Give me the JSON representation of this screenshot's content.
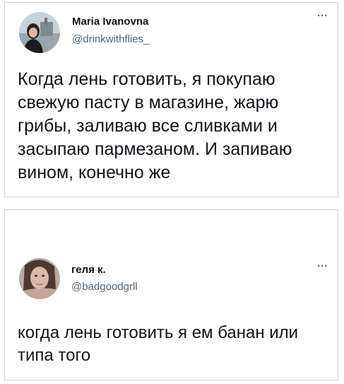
{
  "tweets": [
    {
      "author_name": "Maria Ivanovna",
      "handle": "@drinkwithflies_",
      "more_label": "···",
      "text": "Когда лень готовить, я покупаю свежую пасту в магазине, жарю грибы, заливаю все сливками и засыпаю пармезаном. И запиваю вином, конечно же",
      "avatar_icon": "profile-photo"
    },
    {
      "author_name": "геля к.",
      "handle": "@badgoodgrll",
      "more_label": "···",
      "text": "когда лень готовить я ем банан или типа того",
      "avatar_icon": "profile-photo"
    }
  ],
  "colors": {
    "text": "#0f1419",
    "secondary": "#536471",
    "border": "#cfd4d9"
  }
}
